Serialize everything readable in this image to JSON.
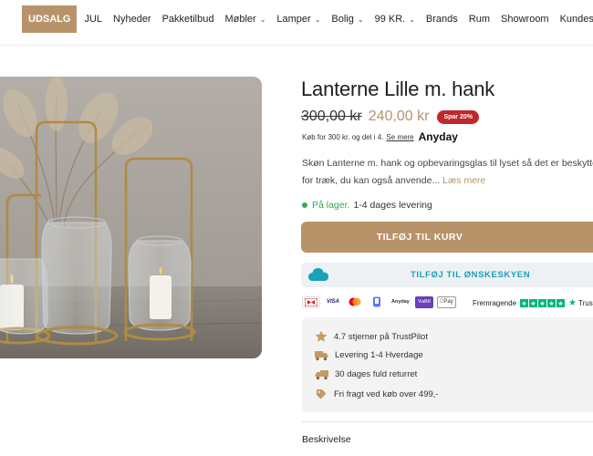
{
  "nav": {
    "items": [
      {
        "label": "UDSALG",
        "dropdown": false
      },
      {
        "label": "JUL",
        "dropdown": false
      },
      {
        "label": "Nyheder",
        "dropdown": false
      },
      {
        "label": "Pakketilbud",
        "dropdown": false
      },
      {
        "label": "Møbler",
        "dropdown": true
      },
      {
        "label": "Lamper",
        "dropdown": true
      },
      {
        "label": "Bolig",
        "dropdown": true
      },
      {
        "label": "99 KR.",
        "dropdown": true
      },
      {
        "label": "Brands",
        "dropdown": false
      },
      {
        "label": "Rum",
        "dropdown": false
      },
      {
        "label": "Showroom",
        "dropdown": false
      },
      {
        "label": "Kundeservice",
        "dropdown": false
      }
    ],
    "chevron_icon": "chevron-down-icon"
  },
  "product": {
    "image_icon": "lantern-product-photo",
    "title": "Lanterne Lille m. hank",
    "old_price": "300,00 kr",
    "new_price": "240,00 kr",
    "save_badge": "Spar 20%",
    "anyday_text": "Køb for 300 kr. og del i 4.",
    "anyday_link": "Se mere",
    "anyday_logo": "Anyday",
    "description": "Skøn Lanterne m. hank og opbevaringsglas til lyset så det er beskyttet for træk, du kan også anvende...",
    "read_more": "Læs mere",
    "stock_status": "På lager.",
    "delivery_time": "1-4 dages levering",
    "add_to_cart": "TILFØJ TIL KURV",
    "wishlist": "TILFØJ TIL ØNSKESKYEN",
    "wishlist_icon": "cloud-icon"
  },
  "payments": [
    {
      "name": "dankort-icon",
      "label": "DK"
    },
    {
      "name": "visa-icon",
      "label": "VISA"
    },
    {
      "name": "mastercard-icon",
      "label": ""
    },
    {
      "name": "mobilepay-icon",
      "label": ""
    },
    {
      "name": "anyday-icon",
      "label": "Anyday"
    },
    {
      "name": "viabill-icon",
      "label": "ViaBill"
    },
    {
      "name": "applepay-icon",
      "label": " Pay"
    }
  ],
  "trustpilot": {
    "rating_word": "Fremragende",
    "brand": "Trust",
    "stars": 5
  },
  "usps": [
    {
      "icon": "star-icon",
      "text": "4.7 stjerner på TrustPilot"
    },
    {
      "icon": "truck-icon",
      "text": "Levering 1-4 Hverdage"
    },
    {
      "icon": "return-truck-icon",
      "text": "30 dages fuld returret"
    },
    {
      "icon": "free-shipping-icon",
      "text": "Fri fragt ved køb over 499,-"
    }
  ],
  "tabs": {
    "description": "Beskrivelse"
  },
  "colors": {
    "accent": "#b8936a",
    "sale_badge": "#c1272d",
    "in_stock": "#3aa655",
    "wishlist_text": "#1aa0b8",
    "trustpilot": "#00b67a"
  }
}
